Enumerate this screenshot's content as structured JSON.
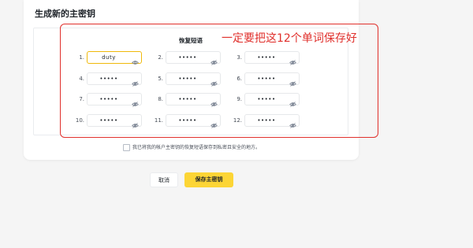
{
  "card": {
    "title": "生成新的主密钥",
    "phrase_heading": "恢复短语"
  },
  "words": [
    {
      "index": "1.",
      "value": "duty",
      "icon": "eye-icon"
    },
    {
      "index": "2.",
      "value": "•••••",
      "icon": "eye-off-icon"
    },
    {
      "index": "3.",
      "value": "•••••",
      "icon": "eye-off-icon"
    },
    {
      "index": "4.",
      "value": "•••••",
      "icon": "eye-off-icon"
    },
    {
      "index": "5.",
      "value": "•••••",
      "icon": "eye-off-icon"
    },
    {
      "index": "6.",
      "value": "•••••",
      "icon": "eye-off-icon"
    },
    {
      "index": "7.",
      "value": "•••••",
      "icon": "eye-off-icon"
    },
    {
      "index": "8.",
      "value": "•••••",
      "icon": "eye-off-icon"
    },
    {
      "index": "9.",
      "value": "•••••",
      "icon": "eye-off-icon"
    },
    {
      "index": "10.",
      "value": "•••••",
      "icon": "eye-off-icon"
    },
    {
      "index": "11.",
      "value": "•••••",
      "icon": "eye-off-icon"
    },
    {
      "index": "12.",
      "value": "•••••",
      "icon": "eye-off-icon"
    }
  ],
  "annotation": {
    "text": "一定要把这12个单词保存好",
    "color": "#e0302c"
  },
  "confirm": {
    "label": "我已将我的帐户主密钥的恢复短语保存到私密且安全的地方。",
    "checked": false
  },
  "buttons": {
    "cancel_label": "取消",
    "save_label": "保存主密钥"
  },
  "colors": {
    "accent": "#fcd535",
    "active_border": "#f0b90b"
  }
}
